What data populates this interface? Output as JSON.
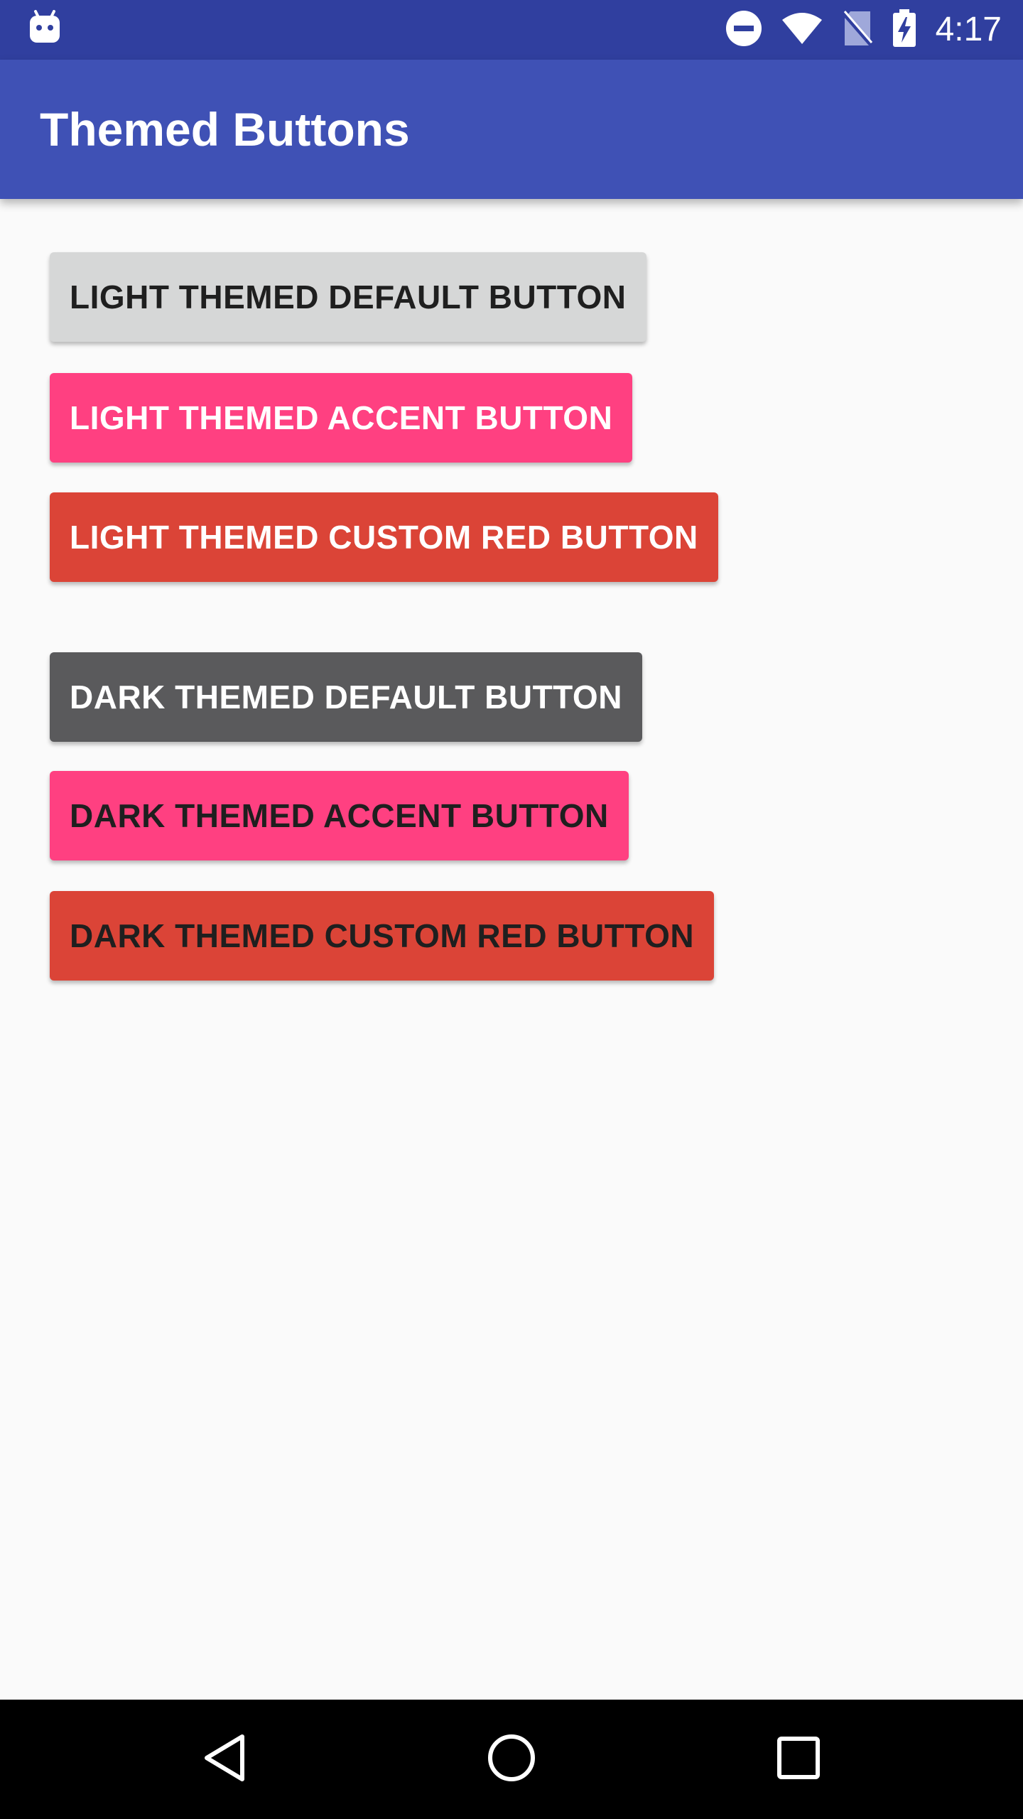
{
  "status_bar": {
    "time": "4:17",
    "icons": [
      "android-notification-icon",
      "do-not-disturb-icon",
      "wifi-icon",
      "no-sim-icon",
      "battery-charging-icon"
    ]
  },
  "app_bar": {
    "title": "Themed Buttons"
  },
  "buttons": {
    "light_default": "LIGHT THEMED DEFAULT BUTTON",
    "light_accent": "LIGHT THEMED ACCENT BUTTON",
    "light_red": "LIGHT THEMED CUSTOM RED BUTTON",
    "dark_default": "DARK THEMED DEFAULT BUTTON",
    "dark_accent": "DARK THEMED ACCENT BUTTON",
    "dark_red": "DARK THEMED CUSTOM RED BUTTON"
  },
  "colors": {
    "status_bar": "#303f9f",
    "primary": "#3f51b5",
    "accent": "#ff4081",
    "custom_red": "#db4437",
    "light_default": "#d6d7d7",
    "dark_default": "#5a5a5c"
  },
  "nav_bar": {
    "icons": [
      "back-icon",
      "home-icon",
      "recents-icon"
    ]
  }
}
